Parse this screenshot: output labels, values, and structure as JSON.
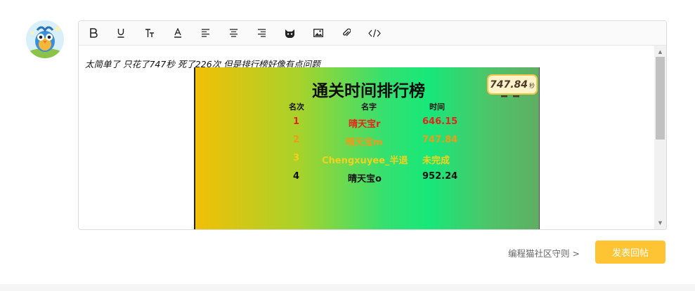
{
  "editor": {
    "post_text": "太简单了 只花了747秒 死了226次 但是排行榜好像有点问题",
    "toolbar": [
      {
        "name": "bold-button",
        "icon": "bold-icon"
      },
      {
        "name": "underline-button",
        "icon": "underline-icon"
      },
      {
        "name": "font-size-button",
        "icon": "font-size-icon"
      },
      {
        "name": "font-color-button",
        "icon": "font-color-icon"
      },
      {
        "name": "align-left-button",
        "icon": "align-left-icon"
      },
      {
        "name": "align-center-button",
        "icon": "align-center-icon"
      },
      {
        "name": "align-right-button",
        "icon": "align-right-icon"
      },
      {
        "name": "emoji-button",
        "icon": "cat-face-icon"
      },
      {
        "name": "insert-image-button",
        "icon": "image-icon"
      },
      {
        "name": "attach-file-button",
        "icon": "paperclip-icon"
      },
      {
        "name": "insert-code-button",
        "icon": "code-icon"
      }
    ]
  },
  "leaderboard": {
    "title": "通关时间排行榜",
    "headers": {
      "rank": "名次",
      "name": "名字",
      "time": "时间"
    },
    "rows": [
      {
        "rank": "1",
        "name": "晴天宝r",
        "time": "646.15",
        "color": "#e8231a"
      },
      {
        "rank": "2",
        "name": "晴天宝m",
        "time": "747.84",
        "color": "#f09a19"
      },
      {
        "rank": "3",
        "name": "Chengxuyee_半退",
        "time": "未完成",
        "color": "#f4d21b"
      },
      {
        "rank": "4",
        "name": "晴天宝o",
        "time": "952.24",
        "color": "#111111"
      }
    ],
    "timer": {
      "value": "747.84",
      "unit": "秒"
    }
  },
  "footer": {
    "guide_link": "编程猫社区守则 >",
    "submit_label": "发表回帖"
  },
  "colors": {
    "accent": "#fec433",
    "border": "#dcdcdc"
  }
}
